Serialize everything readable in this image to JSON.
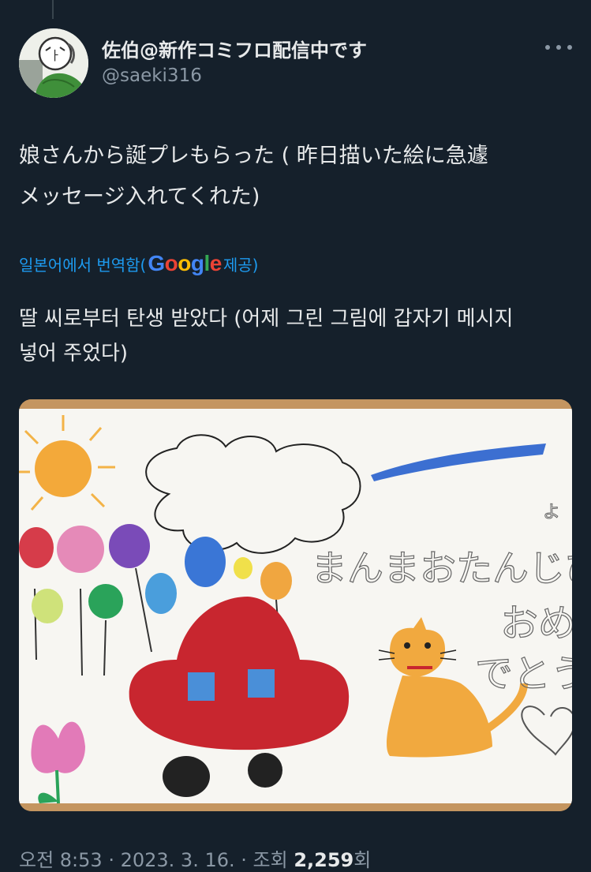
{
  "tweet": {
    "display_name": "佐伯@新作コミフロ配信中です",
    "handle": "@saeki316",
    "text_line1": "娘さんから誕プレもらった ( 昨日描いた絵に急遽",
    "text_line2": "メッセージ入れてくれた)",
    "translate_prefix": "일본어에서 번역함(",
    "translate_google": "Google",
    "translate_suffix": " 제공)",
    "translation_line1": "딸 씨로부터 탄생 받았다 (어제 그린 그림에 갑자기 메시지",
    "translation_line2": "넣어 주었다)",
    "drawing_message": [
      "まんまおたんじび",
      "おめ",
      "でとう"
    ],
    "drawing_small_mark": "よ",
    "time": "오전 8:53",
    "date": "2023. 3. 16.",
    "views_label": "조회",
    "views_count": "2,259",
    "views_unit": "회"
  },
  "colors": {
    "background": "#15202b",
    "text": "#e7e9ea",
    "secondary": "#8b98a5",
    "link": "#1d9bf0"
  },
  "icons": {
    "more": "more-dots-icon",
    "avatar": "user-avatar"
  }
}
